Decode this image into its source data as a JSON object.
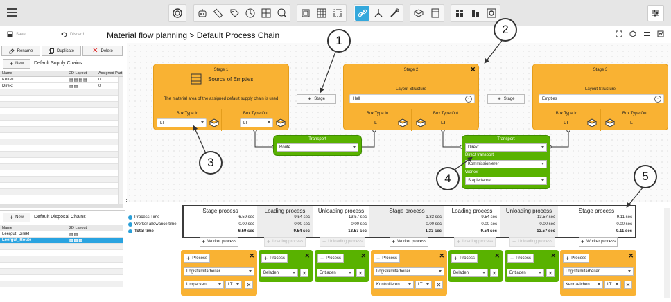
{
  "toolbar": {
    "icons": [
      "rotation-icon",
      "robot-icon",
      "ruler-icon",
      "tag-icon",
      "clock-icon",
      "grid-icon",
      "zoom-icon",
      "frame-icon",
      "table-grid-icon",
      "select-area-icon",
      "link-icon",
      "flow-split-icon",
      "tools-icon",
      "box-stack-icon",
      "calculator-icon",
      "workers-icon",
      "stack-icon",
      "target-icon",
      "settings-icon"
    ],
    "active_color": "#34a8dc"
  },
  "header": {
    "save_label": "Save",
    "discard_label": "Discard",
    "breadcrumb": "Material flow planning  >  Default Process Chain"
  },
  "left_panel": {
    "rename_label": "Rename",
    "duplicate_label": "Duplicate",
    "delete_label": "Delete",
    "supply": {
      "new_label": "New",
      "title": "Default Supply Chains",
      "columns": [
        "Name",
        "2D Layout",
        "Assigned Part"
      ],
      "rows": [
        {
          "name": "Kette1",
          "count": "0"
        },
        {
          "name": "Direkt",
          "count": "0"
        }
      ]
    },
    "disposal": {
      "new_label": "New",
      "title": "Default Disposal Chains",
      "columns": [
        "Name",
        "2D Layout"
      ],
      "rows": [
        {
          "name": "Leergut_Direkt"
        },
        {
          "name": "Leergut_Route"
        }
      ]
    }
  },
  "stages": {
    "s1": {
      "title": "Stage 1",
      "name": "Source of Empties",
      "desc": "The material area of the assigned default supply chain is used",
      "box_in": "Box Type In",
      "box_out": "Box Type Out",
      "in_value": "LT",
      "out_value": "LT"
    },
    "s2": {
      "title": "Stage 2",
      "layout": "Layout Structure",
      "layout_value": "Hall",
      "box_in": "Box Type In",
      "box_out": "Box Type Out",
      "in_value": "LT",
      "out_value": "LT"
    },
    "s3": {
      "title": "Stage 3",
      "layout": "Layout Structure",
      "layout_value": "Empties",
      "box_in": "Box Type In",
      "box_out": "Box Type Out",
      "in_value": "LT",
      "out_value": "LT"
    },
    "stage_button": "Stage"
  },
  "transports": {
    "t1": {
      "title": "Transport",
      "value": "Route"
    },
    "t2": {
      "title": "Transport",
      "value": "Direkt",
      "direct_label": "Direct transport",
      "direct_value": "Kommissionierer",
      "worker_label": "Worker",
      "worker_value": "Staplerfahrer"
    }
  },
  "process_table": {
    "row_labels": [
      "Process Time",
      "Worker allowance time",
      "Total time"
    ],
    "columns": [
      {
        "header": "Stage process",
        "values": [
          "6.59 sec",
          "0.00 sec",
          "6.59 sec"
        ]
      },
      {
        "header": "Loading process",
        "values": [
          "9.54 sec",
          "0.00 sec",
          "9.54 sec"
        ]
      },
      {
        "header": "Unloading process",
        "values": [
          "13.57 sec",
          "0.00 sec",
          "13.57 sec"
        ]
      },
      {
        "header": "Stage process",
        "values": [
          "1.33 sec",
          "0.00 sec",
          "1.33 sec"
        ]
      },
      {
        "header": "Loading process",
        "values": [
          "9.54 sec",
          "0.00 sec",
          "9.54 sec"
        ]
      },
      {
        "header": "Unloading process",
        "values": [
          "13.57 sec",
          "0.00 sec",
          "13.57 sec"
        ]
      },
      {
        "header": "Stage process",
        "values": [
          "9.11 sec",
          "0.00 sec",
          "9.11 sec"
        ]
      }
    ]
  },
  "worker_process": {
    "label_wp": "Worker process",
    "label_lp": "Loading process",
    "label_up": "Unloading process",
    "process_label": "Process"
  },
  "process_boxes": {
    "b1": {
      "worker": "Logistikmitarbeiter",
      "task": "Umpacken",
      "unit": "LT"
    },
    "b2": {
      "task": "Beladen"
    },
    "b3": {
      "task": "Entladen"
    },
    "b4": {
      "worker": "Logistikmitarbeiter",
      "task": "Kontrollieren",
      "unit": "LT"
    },
    "b5": {
      "task": "Beladen"
    },
    "b6": {
      "task": "Entladen"
    },
    "b7": {
      "worker": "Logistikmitarbeiter",
      "task": "Kennzeichen",
      "unit": "LT"
    }
  },
  "callouts": [
    "1",
    "2",
    "3",
    "4",
    "5"
  ],
  "colors": {
    "stage": "#f9b233",
    "transport": "#59b200",
    "selection": "#29a3e0"
  }
}
